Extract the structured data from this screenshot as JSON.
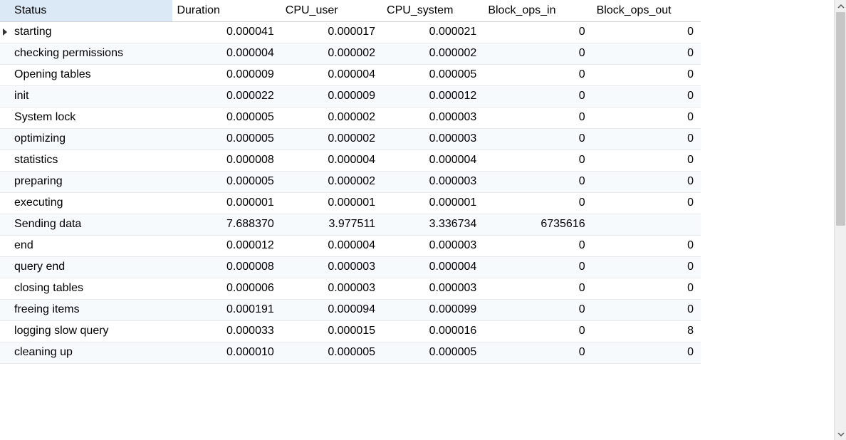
{
  "table": {
    "headers": {
      "status": "Status",
      "duration": "Duration",
      "cpu_user": "CPU_user",
      "cpu_system": "CPU_system",
      "block_ops_in": "Block_ops_in",
      "block_ops_out": "Block_ops_out"
    },
    "current_row": 0,
    "rows": [
      {
        "status": "starting",
        "duration": "0.000041",
        "cpu_user": "0.000017",
        "cpu_system": "0.000021",
        "block_ops_in": "0",
        "block_ops_out": "0"
      },
      {
        "status": "checking permissions",
        "duration": "0.000004",
        "cpu_user": "0.000002",
        "cpu_system": "0.000002",
        "block_ops_in": "0",
        "block_ops_out": "0"
      },
      {
        "status": "Opening tables",
        "duration": "0.000009",
        "cpu_user": "0.000004",
        "cpu_system": "0.000005",
        "block_ops_in": "0",
        "block_ops_out": "0"
      },
      {
        "status": "init",
        "duration": "0.000022",
        "cpu_user": "0.000009",
        "cpu_system": "0.000012",
        "block_ops_in": "0",
        "block_ops_out": "0"
      },
      {
        "status": "System lock",
        "duration": "0.000005",
        "cpu_user": "0.000002",
        "cpu_system": "0.000003",
        "block_ops_in": "0",
        "block_ops_out": "0"
      },
      {
        "status": "optimizing",
        "duration": "0.000005",
        "cpu_user": "0.000002",
        "cpu_system": "0.000003",
        "block_ops_in": "0",
        "block_ops_out": "0"
      },
      {
        "status": "statistics",
        "duration": "0.000008",
        "cpu_user": "0.000004",
        "cpu_system": "0.000004",
        "block_ops_in": "0",
        "block_ops_out": "0"
      },
      {
        "status": "preparing",
        "duration": "0.000005",
        "cpu_user": "0.000002",
        "cpu_system": "0.000003",
        "block_ops_in": "0",
        "block_ops_out": "0"
      },
      {
        "status": "executing",
        "duration": "0.000001",
        "cpu_user": "0.000001",
        "cpu_system": "0.000001",
        "block_ops_in": "0",
        "block_ops_out": "0"
      },
      {
        "status": "Sending data",
        "duration": "7.688370",
        "cpu_user": "3.977511",
        "cpu_system": "3.336734",
        "block_ops_in": "6735616",
        "block_ops_out": ""
      },
      {
        "status": "end",
        "duration": "0.000012",
        "cpu_user": "0.000004",
        "cpu_system": "0.000003",
        "block_ops_in": "0",
        "block_ops_out": "0"
      },
      {
        "status": "query end",
        "duration": "0.000008",
        "cpu_user": "0.000003",
        "cpu_system": "0.000004",
        "block_ops_in": "0",
        "block_ops_out": "0"
      },
      {
        "status": "closing tables",
        "duration": "0.000006",
        "cpu_user": "0.000003",
        "cpu_system": "0.000003",
        "block_ops_in": "0",
        "block_ops_out": "0"
      },
      {
        "status": "freeing items",
        "duration": "0.000191",
        "cpu_user": "0.000094",
        "cpu_system": "0.000099",
        "block_ops_in": "0",
        "block_ops_out": "0"
      },
      {
        "status": "logging slow query",
        "duration": "0.000033",
        "cpu_user": "0.000015",
        "cpu_system": "0.000016",
        "block_ops_in": "0",
        "block_ops_out": "8"
      },
      {
        "status": "cleaning up",
        "duration": "0.000010",
        "cpu_user": "0.000005",
        "cpu_system": "0.000005",
        "block_ops_in": "0",
        "block_ops_out": "0"
      }
    ]
  }
}
